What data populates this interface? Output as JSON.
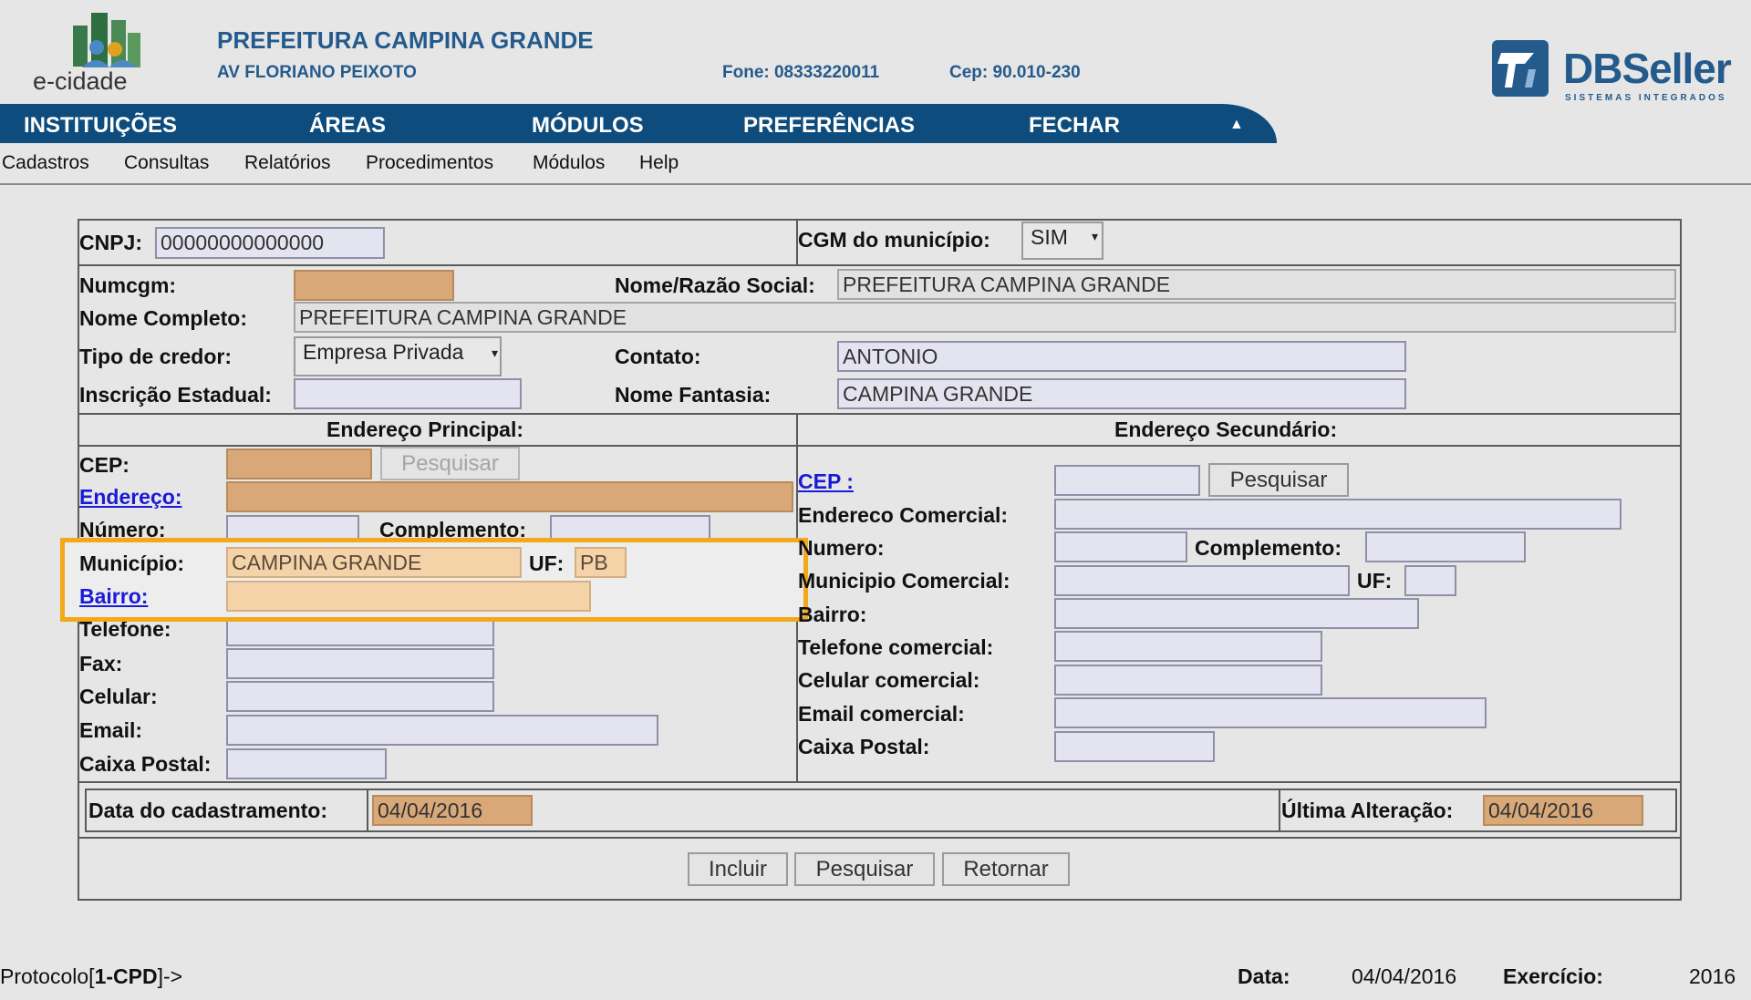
{
  "header": {
    "logo_text": "e-cidade",
    "org_title": "PREFEITURA CAMPINA GRANDE",
    "org_address": "AV FLORIANO PEIXOTO",
    "phone": "Fone: 08333220011",
    "cep": "Cep: 90.010-230",
    "vendor_logo": "DBSeller",
    "vendor_tagline": "SISTEMAS INTEGRADOS"
  },
  "topnav": {
    "items": [
      "INSTITUIÇÕES",
      "ÁREAS",
      "MÓDULOS",
      "PREFERÊNCIAS",
      "FECHAR"
    ],
    "collapse_icon": "▲"
  },
  "menubar": {
    "items": [
      "Cadastros",
      "Consultas",
      "Relatórios",
      "Procedimentos",
      "Módulos",
      "Help"
    ]
  },
  "form": {
    "cnpj_label": "CNPJ:",
    "cnpj_value": "00000000000000",
    "cgm_label": "CGM do município:",
    "cgm_value": "SIM",
    "numcgm_label": "Numcgm:",
    "numcgm_value": "",
    "nome_razao_label": "Nome/Razão Social:",
    "nome_razao_value": "PREFEITURA CAMPINA GRANDE",
    "nome_completo_label": "Nome Completo:",
    "nome_completo_value": "PREFEITURA CAMPINA GRANDE",
    "tipo_credor_label": "Tipo de credor:",
    "tipo_credor_value": "Empresa Privada",
    "contato_label": "Contato:",
    "contato_value": "ANTONIO",
    "inscricao_label": "Inscrição Estadual:",
    "inscricao_value": "",
    "nome_fantasia_label": "Nome Fantasia:",
    "nome_fantasia_value": "CAMPINA GRANDE",
    "principal": {
      "title": "Endereço Principal:",
      "cep_label": "CEP:",
      "pesquisar_label": "Pesquisar",
      "endereco_label": "Endereço:",
      "numero_label": "Número:",
      "complemento_label": "Complemento:",
      "municipio_label": "Município:",
      "municipio_value": "CAMPINA GRANDE",
      "uf_label": "UF:",
      "uf_value": "PB",
      "bairro_label": "Bairro:",
      "telefone_label": "Telefone:",
      "fax_label": "Fax:",
      "celular_label": "Celular:",
      "email_label": "Email:",
      "caixa_postal_label": "Caixa Postal:"
    },
    "secundario": {
      "title": "Endereço Secundário:",
      "cep_label": "CEP :",
      "pesquisar_label": "Pesquisar",
      "endereco_label": "Endereco Comercial:",
      "numero_label": "Numero:",
      "complemento_label": "Complemento:",
      "municipio_label": "Municipio Comercial:",
      "uf_label": "UF:",
      "bairro_label": "Bairro:",
      "telefone_label": "Telefone comercial:",
      "celular_label": "Celular comercial:",
      "email_label": "Email comercial:",
      "caixa_postal_label": "Caixa Postal:"
    },
    "data_cadastro_label": "Data do cadastramento:",
    "data_cadastro_value": "04/04/2016",
    "ultima_alteracao_label": "Última Alteração:",
    "ultima_alteracao_value": "04/04/2016",
    "buttons": {
      "incluir": "Incluir",
      "pesquisar": "Pesquisar",
      "retornar": "Retornar"
    }
  },
  "footer": {
    "protocolo_prefix": "Protocolo[",
    "protocolo_bold": "1-CPD",
    "protocolo_suffix": "]->",
    "data_label": "Data:",
    "data_value": "04/04/2016",
    "exercicio_label": "Exercício:",
    "exercicio_value": "2016"
  },
  "colors": {
    "nav_bg": "#0d4c7c",
    "brand_text": "#245b8c",
    "highlight": "#f2a818",
    "link": "#1a1ad8"
  }
}
